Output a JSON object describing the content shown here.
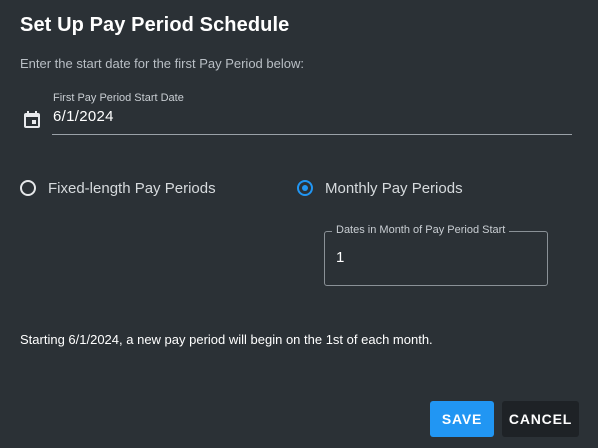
{
  "dialog": {
    "title": "Set Up Pay Period Schedule",
    "instruction": "Enter the start date for the first Pay Period below:"
  },
  "start_date": {
    "label": "First Pay Period Start Date",
    "value": "6/1/2024",
    "icon": "calendar-icon"
  },
  "period_type": {
    "options": [
      {
        "label": "Fixed-length Pay Periods",
        "selected": false
      },
      {
        "label": "Monthly Pay Periods",
        "selected": true
      }
    ]
  },
  "month_dates": {
    "label": "Dates in Month of Pay Period Start",
    "value": "1"
  },
  "summary": "Starting 6/1/2024, a new pay period will begin on the 1st of each month.",
  "actions": {
    "save_label": "SAVE",
    "cancel_label": "CANCEL"
  },
  "colors": {
    "accent": "#2196f3",
    "background": "#2b3136",
    "cancel_bg": "#1e2226"
  }
}
